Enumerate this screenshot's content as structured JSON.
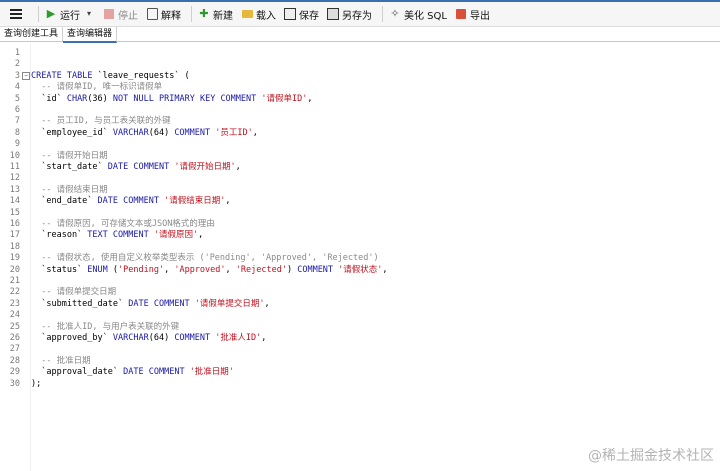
{
  "toolbar": {
    "run": "运行",
    "stop": "停止",
    "explain": "解释",
    "new": "新建",
    "load": "载入",
    "save": "保存",
    "save_as": "另存为",
    "beautify": "美化 SQL",
    "export": "导出"
  },
  "tabs": [
    "查询创建工具",
    "查询编辑器"
  ],
  "editor": {
    "lines": [
      {
        "n": "1",
        "t": ""
      },
      {
        "n": "2",
        "t": ""
      },
      {
        "n": "3",
        "t": "CREATE TABLE `leave_requests` ("
      },
      {
        "n": "4",
        "t": "  -- 请假单ID, 唯一标识请假单"
      },
      {
        "n": "5",
        "t": "  `id` CHAR(36) NOT NULL PRIMARY KEY COMMENT '请假单ID',"
      },
      {
        "n": "6",
        "t": ""
      },
      {
        "n": "7",
        "t": "  -- 员工ID, 与员工表关联的外键"
      },
      {
        "n": "8",
        "t": "  `employee_id` VARCHAR(64) COMMENT '员工ID',"
      },
      {
        "n": "9",
        "t": ""
      },
      {
        "n": "10",
        "t": "  -- 请假开始日期"
      },
      {
        "n": "11",
        "t": "  `start_date` DATE COMMENT '请假开始日期',"
      },
      {
        "n": "12",
        "t": ""
      },
      {
        "n": "13",
        "t": "  -- 请假结束日期"
      },
      {
        "n": "14",
        "t": "  `end_date` DATE COMMENT '请假结束日期',"
      },
      {
        "n": "15",
        "t": ""
      },
      {
        "n": "16",
        "t": "  -- 请假原因, 可存储文本或JSON格式的理由"
      },
      {
        "n": "17",
        "t": "  `reason` TEXT COMMENT '请假原因',"
      },
      {
        "n": "18",
        "t": ""
      },
      {
        "n": "19",
        "t": "  -- 请假状态, 使用自定义枚举类型表示 ('Pending', 'Approved', 'Rejected')"
      },
      {
        "n": "20",
        "t": "  `status` ENUM ('Pending', 'Approved', 'Rejected') COMMENT '请假状态',"
      },
      {
        "n": "21",
        "t": ""
      },
      {
        "n": "22",
        "t": "  -- 请假单提交日期"
      },
      {
        "n": "23",
        "t": "  `submitted_date` DATE COMMENT '请假单提交日期',"
      },
      {
        "n": "24",
        "t": ""
      },
      {
        "n": "25",
        "t": "  -- 批准人ID, 与用户表关联的外键"
      },
      {
        "n": "26",
        "t": "  `approved_by` VARCHAR(64) COMMENT '批准人ID',"
      },
      {
        "n": "27",
        "t": ""
      },
      {
        "n": "28",
        "t": "  -- 批准日期"
      },
      {
        "n": "29",
        "t": "  `approval_date` DATE COMMENT '批准日期'"
      },
      {
        "n": "30",
        "t": ");"
      }
    ]
  },
  "watermark": "@稀土掘金技术社区",
  "colors": {
    "keyword": "#1a1aa6",
    "string": "#c1121f",
    "comment": "#8a8a8a",
    "accent": "#3a6fb0"
  }
}
